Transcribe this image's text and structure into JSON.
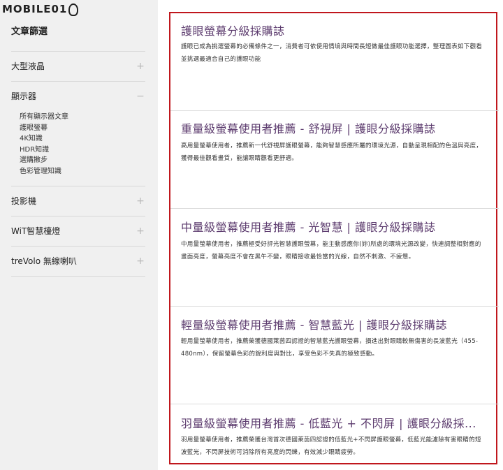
{
  "watermark": {
    "text": "MOBILE01"
  },
  "sidebar": {
    "title": "文章篩選",
    "categories": [
      {
        "label": "大型液晶",
        "toggle": "+"
      },
      {
        "label": "顯示器",
        "toggle": "−",
        "subitems": [
          "所有顯示器文章",
          "護眼螢幕",
          "4K知識",
          "HDR知識",
          "選購撇步",
          "色彩管理知識"
        ]
      },
      {
        "label": "投影機",
        "toggle": "+"
      },
      {
        "label": "WiT智慧檯燈",
        "toggle": "+"
      },
      {
        "label": "treVolo 無線喇叭",
        "toggle": "+"
      }
    ]
  },
  "articles": [
    {
      "title": "護眼螢幕分級採購誌",
      "desc": "護眼已成為挑選螢幕的必備條件之一，消費者可依使用情境與時間長短做最佳護眼功能選擇，整理圖表如下觀看並挑選最適合自己的護眼功能"
    },
    {
      "title": "重量級螢幕使用者推薦 - 舒視屏 | 護眼分級採購誌",
      "desc": "高用量螢幕使用者，推薦新一代舒視屏護眼螢幕，能夠智慧感應所屬的環境光源，自動呈現相配的色溫與亮度，獲得最佳觀看畫質，能讓眼睛觀看更舒適。"
    },
    {
      "title": "中量級螢幕使用者推薦 - 光智慧 | 護眼分級採購誌",
      "desc": "中用量螢幕使用者，推薦極受好評光智慧護眼螢幕，能主動感應你(妳)所處的環境光源改變，快速調整相對應的畫面亮度，螢幕亮度不會在黑午不變，眼睛接收最恰當的光線，自然不刺激、不疲憊。"
    },
    {
      "title": "輕量級螢幕使用者推薦 - 智慧藍光 | 護眼分級採購誌",
      "desc": "輕用量螢幕使用者，推薦榮獲德國萊茵四認證的智慧藍光護眼螢幕，損進出對眼睛較無傷害的長波藍光（455-480nm），保留螢幕色彩的銳利度與對比，享受色彩不失真的極致感動。"
    },
    {
      "title": "羽量級螢幕使用者推薦 - 低藍光 + 不閃屏 | 護眼分級採...",
      "desc": "羽用量螢幕使用者，推薦榮獲台灣首次德國萊茵四認證的低藍光+不閃屏護眼螢幕，低藍光能濾除有害眼睛的短波藍光，不閃屏技術可消除所有亮度的閃爍，有效減少眼睛疲勞。"
    }
  ],
  "colors": {
    "accent_border": "#c0171d",
    "title": "#5c3b6e",
    "sidebar_bg": "#f0f0f0"
  }
}
